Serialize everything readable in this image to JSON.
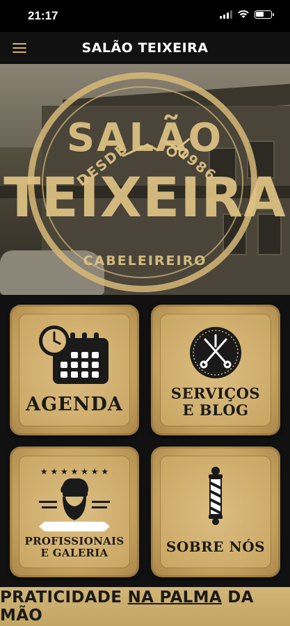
{
  "status_bar": {
    "time": "21:17"
  },
  "header": {
    "title": "SALÃO TEIXEIRA"
  },
  "hero": {
    "logo_desde": "DESDE",
    "logo_year": "1986",
    "logo_salao": "SALÃO",
    "logo_teixeira": "TEIXEIRA",
    "logo_cabeleireiro": "CABELEIREIRO"
  },
  "menu": {
    "agenda": {
      "label": "AGENDA",
      "icon": "calendar-clock-icon"
    },
    "servicos": {
      "label_line1": "SERVIÇOS",
      "label_line2": "E BLOG",
      "icon": "barber-tools-badge-icon"
    },
    "profissionais": {
      "label_line1": "PROFISSIONAIS",
      "label_line2": "E GALERIA",
      "icon": "bearded-man-icon"
    },
    "sobre": {
      "label": "SOBRE NÓS",
      "icon": "barber-pole-icon"
    }
  },
  "footer": {
    "part1": "PRATICIDADE ",
    "part2": "NA PALMA",
    "part3": " DA MÃO"
  },
  "colors": {
    "gold": "#c9a663",
    "dark": "#111111",
    "accent": "#d4b46a"
  }
}
